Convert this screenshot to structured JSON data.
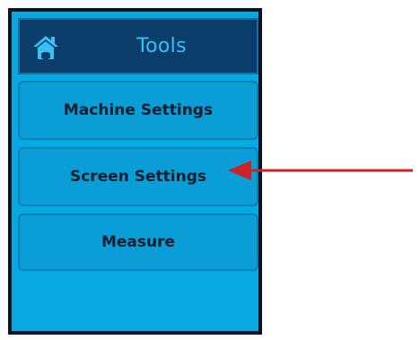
{
  "header": {
    "title": "Tools",
    "icon": "home-icon"
  },
  "menu": {
    "items": [
      {
        "label": "Machine Settings"
      },
      {
        "label": "Screen Settings"
      },
      {
        "label": "Measure"
      }
    ]
  },
  "annotation": {
    "arrow_color": "#cc2229",
    "target": "Screen Settings"
  },
  "colors": {
    "screen_bg": "#06a9e4",
    "header_bg": "#0a3d6a",
    "button_bg": "#0a9dd6",
    "title_text": "#36c2f5"
  }
}
